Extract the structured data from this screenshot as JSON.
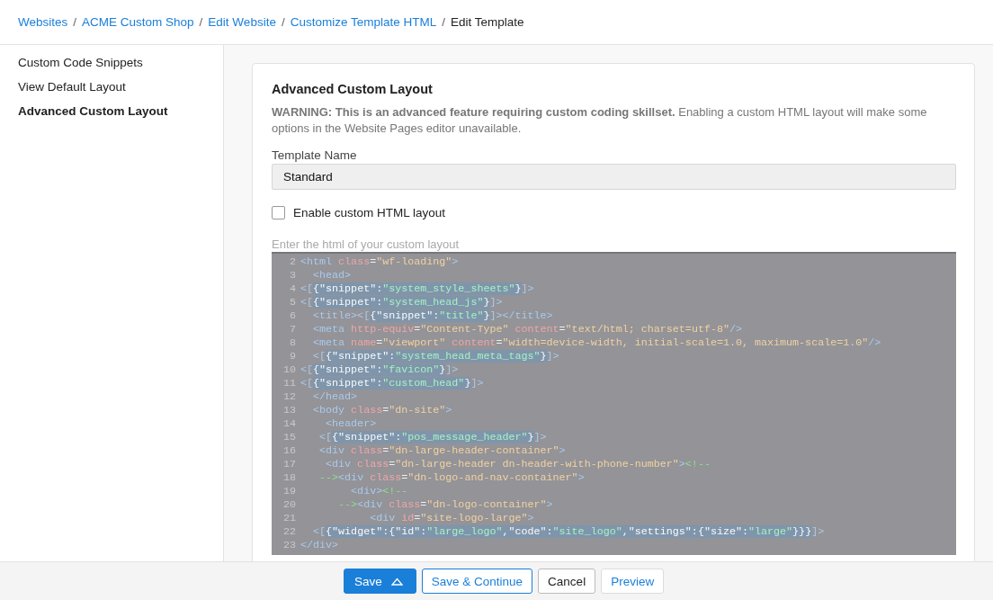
{
  "breadcrumb": [
    {
      "label": "Websites",
      "kind": "link"
    },
    {
      "label": "/",
      "kind": "separator"
    },
    {
      "label": "ACME Custom Shop",
      "kind": "link"
    },
    {
      "label": "/",
      "kind": "separator"
    },
    {
      "label": "Edit Website",
      "kind": "link"
    },
    {
      "label": "/",
      "kind": "separator"
    },
    {
      "label": "Customize Template HTML",
      "kind": "link"
    },
    {
      "label": "/",
      "kind": "separator"
    },
    {
      "label": "Edit Template",
      "kind": "current"
    }
  ],
  "sidebar": {
    "items": [
      {
        "label": "Custom Code Snippets",
        "selected": false
      },
      {
        "label": "View Default Layout",
        "selected": false
      },
      {
        "label": "Advanced Custom Layout",
        "selected": true
      }
    ]
  },
  "card": {
    "title": "Advanced Custom Layout",
    "warning": "**WARNING: This is an advanced feature requiring custom coding skillset.** Enabling a custom HTML layout will make some options in the Website Pages editor unavailable.",
    "template_name": {
      "label": "Template Name",
      "value": "Standard"
    },
    "enable_custom": {
      "label": "Enable custom HTML layout",
      "checked": false
    },
    "editor": {
      "label": "Enter the html of your custom layout",
      "lines": [
        {
          "number": "2",
          "tokens": [
            {
              "kind": "tag",
              "text": "<html"
            },
            {
              "kind": "attr",
              "text": " class"
            },
            {
              "kind": "plain",
              "text": "="
            },
            {
              "kind": "str",
              "text": "\"wf-loading\""
            },
            {
              "kind": "tag",
              "text": ">"
            }
          ]
        },
        {
          "number": "3",
          "tokens": [
            {
              "kind": "tag",
              "text": "  <head>"
            }
          ]
        },
        {
          "number": "4",
          "tokens": [
            {
              "kind": "tag",
              "text": "<["
            },
            {
              "kind": "jkey",
              "text": "{\"snippet\":"
            },
            {
              "kind": "jstr",
              "text": "\"system_style_sheets\""
            },
            {
              "kind": "jkey",
              "text": "}"
            },
            {
              "kind": "tag",
              "text": "]>"
            }
          ]
        },
        {
          "number": "5",
          "tokens": [
            {
              "kind": "tag",
              "text": "<["
            },
            {
              "kind": "jkey",
              "text": "{\"snippet\":"
            },
            {
              "kind": "jstr",
              "text": "\"system_head_js\""
            },
            {
              "kind": "jkey",
              "text": "}"
            },
            {
              "kind": "tag",
              "text": "]>"
            }
          ]
        },
        {
          "number": "6",
          "tokens": [
            {
              "kind": "tag",
              "text": "  <title><["
            },
            {
              "kind": "jkey",
              "text": "{\"snippet\":"
            },
            {
              "kind": "jstr",
              "text": "\"title\""
            },
            {
              "kind": "jkey",
              "text": "}"
            },
            {
              "kind": "tag",
              "text": "]></title>"
            }
          ]
        },
        {
          "number": "7",
          "tokens": [
            {
              "kind": "tag",
              "text": "  <meta"
            },
            {
              "kind": "attr",
              "text": " http-equiv"
            },
            {
              "kind": "plain",
              "text": "="
            },
            {
              "kind": "str",
              "text": "\"Content-Type\""
            },
            {
              "kind": "attr",
              "text": " content"
            },
            {
              "kind": "plain",
              "text": "="
            },
            {
              "kind": "str",
              "text": "\"text/html; charset=utf-8\""
            },
            {
              "kind": "tag",
              "text": "/>"
            }
          ]
        },
        {
          "number": "8",
          "tokens": [
            {
              "kind": "tag",
              "text": "  <meta"
            },
            {
              "kind": "attr",
              "text": " name"
            },
            {
              "kind": "plain",
              "text": "="
            },
            {
              "kind": "str",
              "text": "\"viewport\""
            },
            {
              "kind": "attr",
              "text": " content"
            },
            {
              "kind": "plain",
              "text": "="
            },
            {
              "kind": "str",
              "text": "\"width=device-width, initial-scale=1.0, maximum-scale=1.0\""
            },
            {
              "kind": "tag",
              "text": "/>"
            }
          ]
        },
        {
          "number": "9",
          "tokens": [
            {
              "kind": "tag",
              "text": "  <["
            },
            {
              "kind": "jkey",
              "text": "{\"snippet\":"
            },
            {
              "kind": "jstr",
              "text": "\"system_head_meta_tags\""
            },
            {
              "kind": "jkey",
              "text": "}"
            },
            {
              "kind": "tag",
              "text": "]>"
            }
          ]
        },
        {
          "number": "10",
          "tokens": [
            {
              "kind": "tag",
              "text": "<["
            },
            {
              "kind": "jkey",
              "text": "{\"snippet\":"
            },
            {
              "kind": "jstr",
              "text": "\"favicon\""
            },
            {
              "kind": "jkey",
              "text": "}"
            },
            {
              "kind": "tag",
              "text": "]>"
            }
          ]
        },
        {
          "number": "11",
          "tokens": [
            {
              "kind": "tag",
              "text": "<["
            },
            {
              "kind": "jkey",
              "text": "{\"snippet\":"
            },
            {
              "kind": "jstr",
              "text": "\"custom_head\""
            },
            {
              "kind": "jkey",
              "text": "}"
            },
            {
              "kind": "tag",
              "text": "]>"
            }
          ]
        },
        {
          "number": "12",
          "tokens": [
            {
              "kind": "tag",
              "text": "  </head>"
            }
          ]
        },
        {
          "number": "13",
          "tokens": [
            {
              "kind": "tag",
              "text": "  <body"
            },
            {
              "kind": "attr",
              "text": " class"
            },
            {
              "kind": "plain",
              "text": "="
            },
            {
              "kind": "str",
              "text": "\"dn-site\""
            },
            {
              "kind": "tag",
              "text": ">"
            }
          ]
        },
        {
          "number": "14",
          "tokens": [
            {
              "kind": "tag",
              "text": "    <header>"
            }
          ]
        },
        {
          "number": "15",
          "tokens": [
            {
              "kind": "tag",
              "text": "   <["
            },
            {
              "kind": "jkey",
              "text": "{\"snippet\":"
            },
            {
              "kind": "jstr",
              "text": "\"pos_message_header\""
            },
            {
              "kind": "jkey",
              "text": "}"
            },
            {
              "kind": "tag",
              "text": "]>"
            }
          ]
        },
        {
          "number": "16",
          "tokens": [
            {
              "kind": "tag",
              "text": "   <div"
            },
            {
              "kind": "attr",
              "text": " class"
            },
            {
              "kind": "plain",
              "text": "="
            },
            {
              "kind": "str",
              "text": "\"dn-large-header-container\""
            },
            {
              "kind": "tag",
              "text": ">"
            }
          ]
        },
        {
          "number": "17",
          "tokens": [
            {
              "kind": "tag",
              "text": "    <div"
            },
            {
              "kind": "attr",
              "text": " class"
            },
            {
              "kind": "plain",
              "text": "="
            },
            {
              "kind": "str",
              "text": "\"dn-large-header dn-header-with-phone-number\""
            },
            {
              "kind": "tag",
              "text": ">"
            },
            {
              "kind": "comment",
              "text": "<!--"
            }
          ]
        },
        {
          "number": "18",
          "tokens": [
            {
              "kind": "comment",
              "text": "   -->"
            },
            {
              "kind": "tag",
              "text": "<div"
            },
            {
              "kind": "attr",
              "text": " class"
            },
            {
              "kind": "plain",
              "text": "="
            },
            {
              "kind": "str",
              "text": "\"dn-logo-and-nav-container\""
            },
            {
              "kind": "tag",
              "text": ">"
            }
          ]
        },
        {
          "number": "19",
          "tokens": [
            {
              "kind": "tag",
              "text": "        <div>"
            },
            {
              "kind": "comment",
              "text": "<!--"
            }
          ]
        },
        {
          "number": "20",
          "tokens": [
            {
              "kind": "comment",
              "text": "      -->"
            },
            {
              "kind": "tag",
              "text": "<div"
            },
            {
              "kind": "attr",
              "text": " class"
            },
            {
              "kind": "plain",
              "text": "="
            },
            {
              "kind": "str",
              "text": "\"dn-logo-container\""
            },
            {
              "kind": "tag",
              "text": ">"
            }
          ]
        },
        {
          "number": "21",
          "tokens": [
            {
              "kind": "tag",
              "text": "           <div"
            },
            {
              "kind": "attr",
              "text": " id"
            },
            {
              "kind": "plain",
              "text": "="
            },
            {
              "kind": "str",
              "text": "\"site-logo-large\""
            },
            {
              "kind": "tag",
              "text": ">"
            }
          ]
        },
        {
          "number": "22",
          "tokens": [
            {
              "kind": "tag",
              "text": "  <["
            },
            {
              "kind": "jkey",
              "text": "{\"widget\":{\"id\":"
            },
            {
              "kind": "jstr",
              "text": "\"large_logo\""
            },
            {
              "kind": "jkey",
              "text": ",\"code\":"
            },
            {
              "kind": "jstr",
              "text": "\"site_logo\""
            },
            {
              "kind": "jkey",
              "text": ",\"settings\":{\"size\":"
            },
            {
              "kind": "jstr",
              "text": "\"large\""
            },
            {
              "kind": "jkey",
              "text": "}}}"
            },
            {
              "kind": "tag",
              "text": "]>"
            }
          ]
        },
        {
          "number": "23",
          "tokens": [
            {
              "kind": "tag",
              "text": "</div>"
            }
          ]
        }
      ]
    }
  },
  "footer": {
    "buttons": [
      {
        "label": "Save",
        "kind": "primary-menu"
      },
      {
        "label": "Save & Continue",
        "kind": "outline"
      },
      {
        "label": "Cancel",
        "kind": "default"
      },
      {
        "label": "Preview",
        "kind": "link"
      }
    ]
  }
}
